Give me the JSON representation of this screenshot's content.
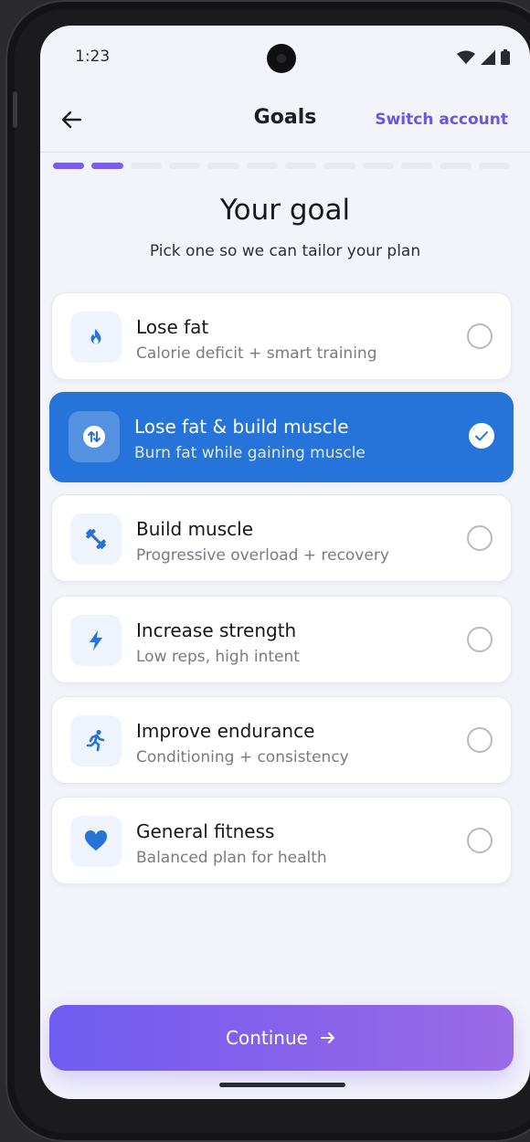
{
  "status_bar": {
    "time": "1:23"
  },
  "app_bar": {
    "title": "Goals",
    "switch_account": "Switch account"
  },
  "progress": {
    "current_step": 2,
    "total_steps": 12
  },
  "heading": "Your goal",
  "subheading": "Pick one so we can tailor your plan",
  "goals": [
    {
      "title": "Lose fat",
      "subtitle": "Calorie deficit + smart training",
      "icon": "flame-icon",
      "selected": false
    },
    {
      "title": "Lose fat & build muscle",
      "subtitle": "Burn fat while gaining muscle",
      "icon": "swap-arrows-icon",
      "selected": true
    },
    {
      "title": "Build muscle",
      "subtitle": "Progressive overload + recovery",
      "icon": "dumbbell-icon",
      "selected": false
    },
    {
      "title": "Increase strength",
      "subtitle": "Low reps, high intent",
      "icon": "lightning-icon",
      "selected": false
    },
    {
      "title": "Improve endurance",
      "subtitle": "Conditioning + consistency",
      "icon": "runner-icon",
      "selected": false
    },
    {
      "title": "General fitness",
      "subtitle": "Balanced plan for health",
      "icon": "heart-icon",
      "selected": false
    }
  ],
  "continue_label": "Continue",
  "colors": {
    "accent": "#2673d9",
    "brand_purple": "#7b5ee8",
    "background": "#f3f3fa"
  }
}
